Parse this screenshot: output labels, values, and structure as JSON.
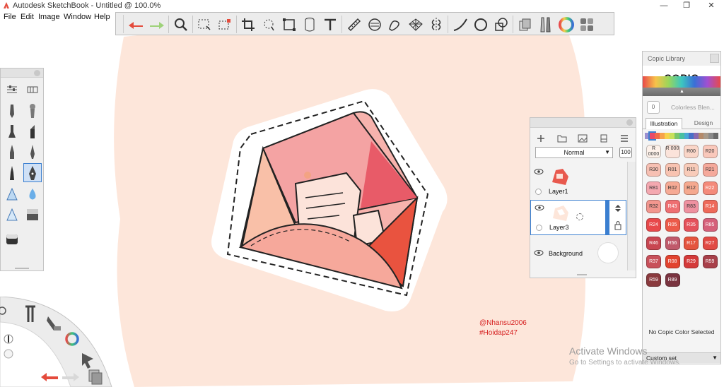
{
  "window": {
    "title": "Autodesk SketchBook - Untitled @ 100.0%",
    "minimize": "—",
    "maximize": "❐",
    "close": "✕"
  },
  "menu": [
    "File",
    "Edit",
    "Image",
    "Window",
    "Help"
  ],
  "toolbar": {
    "icons": [
      "undo-icon",
      "redo-icon",
      "zoom-icon",
      "select-icon",
      "select-add-icon",
      "crop-icon",
      "lasso-icon",
      "transform-icon",
      "perspective-icon",
      "text-icon",
      "ruler-icon",
      "ellipse-guide-icon",
      "french-curve-icon",
      "perspective-grid-icon",
      "symmetry-icon",
      "stroke-icon",
      "shape-icon",
      "fill-icon",
      "layers-icon",
      "brushes-icon",
      "color-wheel-icon",
      "color-swatches-icon"
    ]
  },
  "colors": {
    "accent": "#3b7fd0",
    "canvas_peach": "#fde6da",
    "undo_red": "#e44b3c",
    "watermark": "#d62020"
  },
  "watermark": {
    "line1": "@Nhansu2006",
    "line2": "#Hoidap247"
  },
  "layers": {
    "blend_mode": "Normal",
    "opacity": "100",
    "items": [
      {
        "name": "Layer1"
      },
      {
        "name": "Layer3"
      },
      {
        "name": "Background"
      }
    ]
  },
  "copic": {
    "title": "Copic Library",
    "logo": "COPIC",
    "colorless": "Colorless Blen...",
    "colorless_code": "0",
    "tabs": [
      "Illustration",
      "Design"
    ],
    "swatches": [
      {
        "code": "R 0000",
        "hex": "#fdf1ea"
      },
      {
        "code": "R 000",
        "hex": "#fbe3da"
      },
      {
        "code": "R00",
        "hex": "#fad6c8"
      },
      {
        "code": "R20",
        "hex": "#f9c8bb"
      },
      {
        "code": "R30",
        "hex": "#f7c0b3"
      },
      {
        "code": "R01",
        "hex": "#f8c3b1"
      },
      {
        "code": "R11",
        "hex": "#f8cbb9"
      },
      {
        "code": "R21",
        "hex": "#f5a99b"
      },
      {
        "code": "R81",
        "hex": "#f4a8b0"
      },
      {
        "code": "R02",
        "hex": "#f6aa95"
      },
      {
        "code": "R12",
        "hex": "#f5a98f"
      },
      {
        "code": "R22",
        "hex": "#f48a7a"
      },
      {
        "code": "R32",
        "hex": "#f2968e"
      },
      {
        "code": "R43",
        "hex": "#ee6f72"
      },
      {
        "code": "R83",
        "hex": "#ee91a0"
      },
      {
        "code": "R14",
        "hex": "#ee6a5a"
      },
      {
        "code": "R24",
        "hex": "#e8484a"
      },
      {
        "code": "R05",
        "hex": "#ec5a4a"
      },
      {
        "code": "R35",
        "hex": "#e4515b"
      },
      {
        "code": "R85",
        "hex": "#d5607a"
      },
      {
        "code": "R46",
        "hex": "#c84651"
      },
      {
        "code": "R56",
        "hex": "#c05a6b"
      },
      {
        "code": "R17",
        "hex": "#e4543e"
      },
      {
        "code": "R27",
        "hex": "#e14a44"
      },
      {
        "code": "R37",
        "hex": "#c8505a"
      },
      {
        "code": "R08",
        "hex": "#e2432f"
      },
      {
        "code": "R29",
        "hex": "#d43a3a"
      },
      {
        "code": "R59",
        "hex": "#a8404a"
      },
      {
        "code": "R59",
        "hex": "#8a3a3e"
      },
      {
        "code": "R89",
        "hex": "#7a3440"
      }
    ],
    "status": "No Copic Color Selected",
    "set": "Custom set"
  },
  "os_notice": {
    "line1": "Activate Windows",
    "line2": "Go to Settings to activate Windows."
  }
}
